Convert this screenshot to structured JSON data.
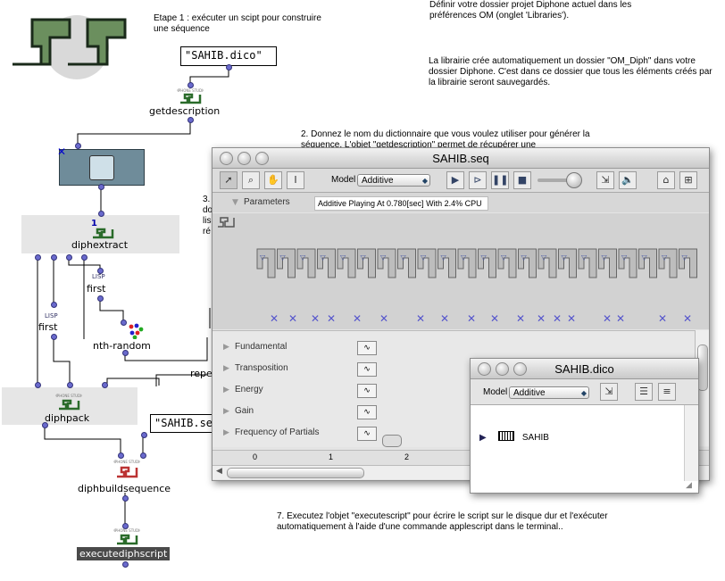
{
  "notes": {
    "step1": "Etape 1 : exécuter un  scipt pour construire une séquence",
    "top_right_1": "Définir votre dossier projet Diphone actuel dans les préférences OM (onglet 'Libraries').",
    "top_right_2": "La librairie crée automatiquement un dossier \"OM_Diph\" dans votre dossier Diphone. C'est dans ce dossier que tous les éléments créés par la librairie seront sauvegardés.",
    "step2": "2. Donnez le nom du dictionnaire que vous voulez utiliser pour générer la séquence. L'objet \"getdescription\" permet de récupérer une",
    "step3_frag": "3.\ndo\nlis\nré",
    "step7": "7. Executez l'objet \"executescript\" pour écrire le script sur le disque dur et l'exécuter automatiquement à l'aide d'une commande applescript dans le terminal.."
  },
  "patch": {
    "dico_box": "\"SAHIB.dico\"",
    "getdescription": "getdescription",
    "diphextract": "diphextract",
    "diphextract_badge": "1",
    "lisp1": "LISP",
    "first1": "first",
    "lisp2": "LISP",
    "first2": "first",
    "nth_random": "nth-random",
    "repeat_frag": "repe",
    "diphpack": "diphpack",
    "seq_box": "\"SAHIB.seq\"",
    "diphbuildsequence": "diphbuildsequence",
    "executediphscript": "executediphscript",
    "diphone_tag": "DIPHONE STUDIO"
  },
  "seq_window": {
    "title": "SAHIB.seq",
    "model_label": "Model",
    "model_value": "Additive",
    "parameters_label": "Parameters",
    "status": "Additive Playing At 0.780[sec] With 2.4% CPU",
    "rows": [
      "Fundamental",
      "Transposition",
      "Energy",
      "Gain",
      "Frequency of Partials"
    ],
    "ruler": [
      "0",
      "1",
      "2"
    ],
    "segments": 22,
    "markers": 18
  },
  "dico_window": {
    "title": "SAHIB.dico",
    "model_label": "Model",
    "model_value": "Additive",
    "item": "SAHIB"
  }
}
